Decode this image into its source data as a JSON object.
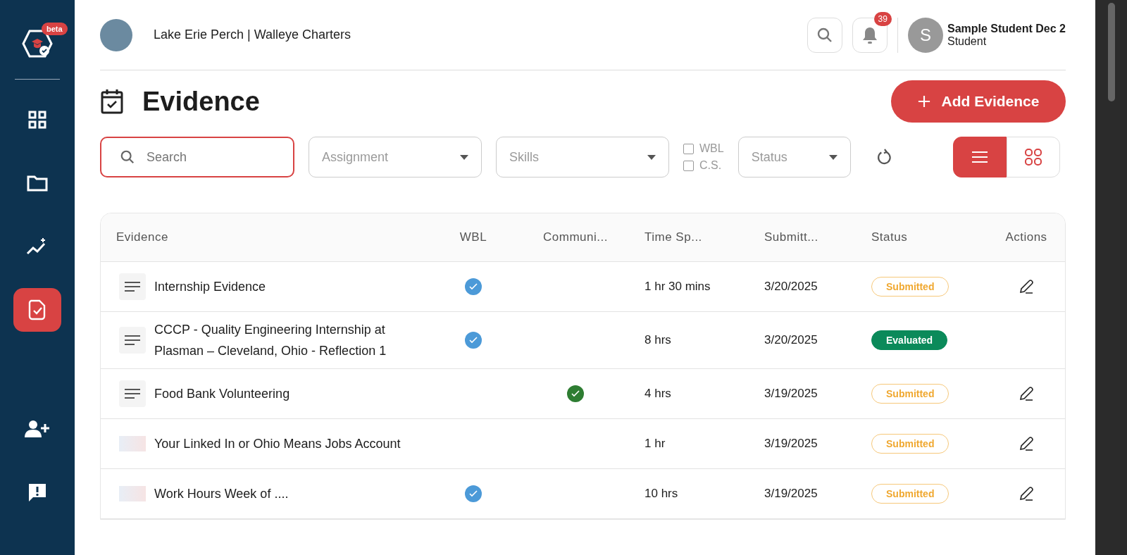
{
  "sidebar": {
    "logo_badge": "beta",
    "items": [
      {
        "selected": false
      },
      {
        "selected": false
      },
      {
        "selected": false
      },
      {
        "selected": true
      }
    ]
  },
  "header": {
    "organization": "Lake Erie Perch | Walleye Charters",
    "notification_count": "39",
    "user": {
      "initial": "S",
      "name": "Sample Student Dec 2",
      "role": "Student"
    }
  },
  "page_title": "Evidence",
  "add_button": "Add Evidence",
  "filters": {
    "search": {
      "placeholder": "Search"
    },
    "dropdowns": [
      {
        "placeholder": "Assignment"
      },
      {
        "placeholder": "Skills"
      }
    ],
    "checkboxes": [
      {
        "label": "WBL",
        "checked": false
      },
      {
        "label": "C.S.",
        "checked": false
      }
    ],
    "status": {
      "placeholder": "Status"
    },
    "views": [
      {
        "selected": true
      },
      {
        "selected": false
      }
    ]
  },
  "table": {
    "columns": [
      "Evidence",
      "WBL",
      "Communi...",
      "Time Sp...",
      "Submitt...",
      "Status",
      "Actions"
    ],
    "rows": [
      {
        "kind": "text",
        "title": "Internship Evidence",
        "wbl": true,
        "community": false,
        "time": "1 hr 30 mins",
        "submitted": "3/20/2025",
        "status": {
          "kind": "submitted",
          "label": "Submitted"
        },
        "editable": true
      },
      {
        "kind": "text",
        "title": "CCCP - Quality Engineering Internship at Plasman – Cleveland, Ohio - Reflection 1",
        "wbl": true,
        "community": false,
        "time": "8 hrs",
        "submitted": "3/20/2025",
        "status": {
          "kind": "evaluated",
          "label": "Evaluated"
        },
        "editable": false
      },
      {
        "kind": "text",
        "title": "Food Bank Volunteering",
        "wbl": false,
        "community": true,
        "time": "4 hrs",
        "submitted": "3/19/2025",
        "status": {
          "kind": "submitted",
          "label": "Submitted"
        },
        "editable": true
      },
      {
        "kind": "image",
        "title": "Your Linked In or Ohio Means Jobs Account",
        "wbl": false,
        "community": false,
        "time": "1 hr",
        "submitted": "3/19/2025",
        "status": {
          "kind": "submitted",
          "label": "Submitted"
        },
        "editable": true
      },
      {
        "kind": "image",
        "title": "Work Hours Week of ....",
        "wbl": true,
        "community": false,
        "time": "10 hrs",
        "submitted": "3/19/2025",
        "status": {
          "kind": "submitted",
          "label": "Submitted"
        },
        "editable": true
      }
    ]
  }
}
